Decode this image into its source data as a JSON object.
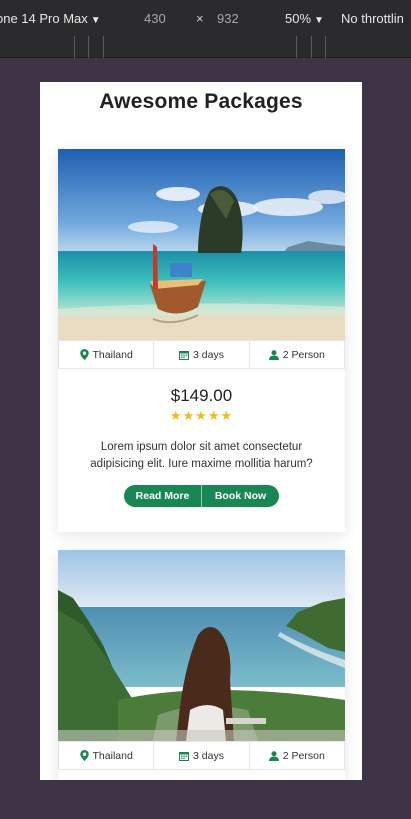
{
  "devtools": {
    "device": "one 14 Pro Max",
    "width": "430",
    "x_sep": "×",
    "height": "932",
    "zoom": "50%",
    "throttle": "No throttlin"
  },
  "page": {
    "title": "Awesome Packages"
  },
  "packages": [
    {
      "location": "Thailand",
      "duration": "3 days",
      "persons": "2 Person",
      "price": "$149.00",
      "rating": 5,
      "stars": "★★★★★",
      "description": "Lorem ipsum dolor sit amet consectetur adipisicing elit. Iure maxime mollitia harum?",
      "read_more": "Read More",
      "book_now": "Book Now"
    },
    {
      "location": "Thailand",
      "duration": "3 days",
      "persons": "2 Person"
    }
  ],
  "colors": {
    "accent": "#198754",
    "star": "#f4b91a"
  }
}
